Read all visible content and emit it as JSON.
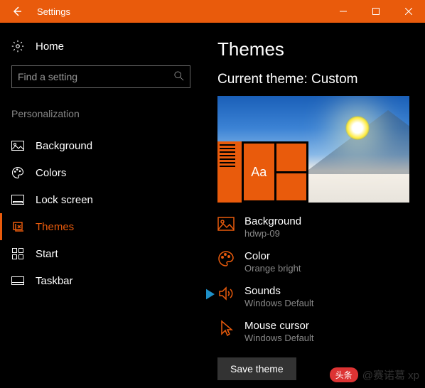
{
  "titlebar": {
    "title": "Settings"
  },
  "sidebar": {
    "home": "Home",
    "search_placeholder": "Find a setting",
    "category": "Personalization",
    "items": [
      {
        "label": "Background"
      },
      {
        "label": "Colors"
      },
      {
        "label": "Lock screen"
      },
      {
        "label": "Themes",
        "active": true
      },
      {
        "label": "Start"
      },
      {
        "label": "Taskbar"
      }
    ]
  },
  "content": {
    "heading": "Themes",
    "subheading": "Current theme: Custom",
    "preview_tile_text": "Aa",
    "options": {
      "background": {
        "label": "Background",
        "value": "hdwp-09"
      },
      "color": {
        "label": "Color",
        "value": "Orange bright"
      },
      "sounds": {
        "label": "Sounds",
        "value": "Windows Default"
      },
      "cursor": {
        "label": "Mouse cursor",
        "value": "Windows Default"
      }
    },
    "save_label": "Save theme"
  },
  "watermark": {
    "badge": "头条",
    "text": "@赛诺葛 xp"
  }
}
